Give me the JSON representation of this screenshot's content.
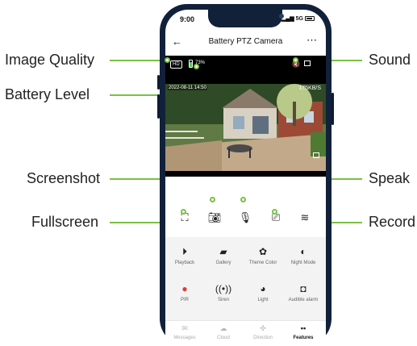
{
  "annotations": {
    "image_quality": "Image Quality",
    "battery_level": "Battery Level",
    "screenshot": "Screenshot",
    "fullscreen": "Fullscreen",
    "sound": "Sound",
    "speak": "Speak",
    "record": "Record"
  },
  "status_bar": {
    "time": "9:00",
    "signal": "5G"
  },
  "header": {
    "title": "Battery PTZ Camera"
  },
  "video": {
    "quality": "HD",
    "battery": "73%",
    "timestamp": "2022-08-11 14:50",
    "bitrate": "175KB/S"
  },
  "features": [
    {
      "label": "Playback",
      "icon": "playback-icon"
    },
    {
      "label": "Gallery",
      "icon": "gallery-icon"
    },
    {
      "label": "Theme Color",
      "icon": "palette-icon"
    },
    {
      "label": "Night Mode",
      "icon": "night-mode-icon"
    },
    {
      "label": "PIR",
      "icon": "pir-icon"
    },
    {
      "label": "Siren",
      "icon": "siren-icon"
    },
    {
      "label": "Light",
      "icon": "light-icon"
    },
    {
      "label": "Audible alarm",
      "icon": "alarm-icon"
    }
  ],
  "tabs": [
    {
      "label": "Messages",
      "icon": "mail-icon"
    },
    {
      "label": "Cloud",
      "icon": "cloud-icon"
    },
    {
      "label": "Direction",
      "icon": "direction-icon"
    },
    {
      "label": "Features",
      "icon": "grid-icon"
    }
  ],
  "colors": {
    "accent": "#79c142",
    "battery": "#4ccd4a",
    "pir": "#e53935"
  }
}
